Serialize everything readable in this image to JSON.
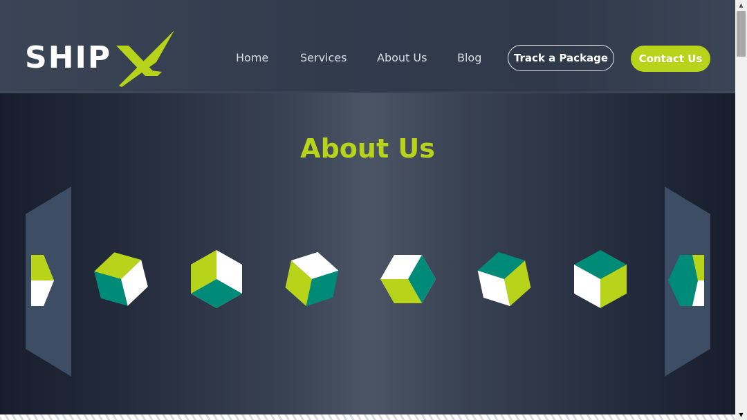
{
  "brand": {
    "name": "SHIP",
    "mark": "X",
    "accent_color": "#b7d41a",
    "teal_color": "#008b78"
  },
  "nav": {
    "items": [
      {
        "label": "Home"
      },
      {
        "label": "Services"
      },
      {
        "label": "About Us"
      },
      {
        "label": "Blog"
      }
    ],
    "track_label": "Track a Package",
    "contact_label": "Contact Us"
  },
  "hero": {
    "title": "About Us"
  },
  "icons": {
    "cube": "isometric-cube-icon",
    "scroll_up": "scroll-up-arrow-icon",
    "scroll_down": "scroll-down-arrow-icon"
  }
}
